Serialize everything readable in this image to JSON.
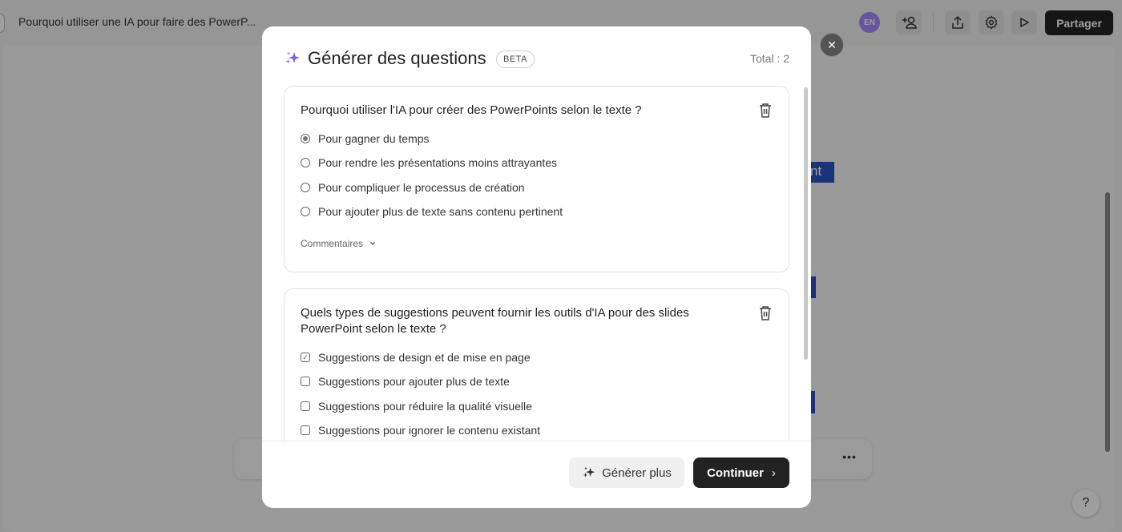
{
  "app": {
    "doc_title": "Pourquoi utiliser une IA pour faire des PowerP...",
    "avatar_initials": "EN",
    "add_user_icon": "+♀",
    "share_label": "Partager",
    "help_label": "?",
    "more_label": "•••",
    "behind_text": "nt"
  },
  "modal": {
    "title": "Générer des questions",
    "badge": "BETA",
    "total": "Total : 2",
    "close_label": "✕",
    "questions": [
      {
        "text": "Pourquoi utiliser l'IA pour créer des PowerPoints selon le texte ?",
        "type": "single",
        "options": [
          {
            "label": "Pour gagner du temps",
            "selected": true
          },
          {
            "label": "Pour rendre les présentations moins attrayantes",
            "selected": false
          },
          {
            "label": "Pour compliquer le processus de création",
            "selected": false
          },
          {
            "label": "Pour ajouter plus de texte sans contenu pertinent",
            "selected": false
          }
        ],
        "comments_label": "Commentaires"
      },
      {
        "text": "Quels types de suggestions peuvent fournir les outils d'IA pour des slides PowerPoint selon le texte ?",
        "type": "multiple",
        "options": [
          {
            "label": "Suggestions de design et de mise en page",
            "selected": true
          },
          {
            "label": "Suggestions pour ajouter plus de texte",
            "selected": false
          },
          {
            "label": "Suggestions pour réduire la qualité visuelle",
            "selected": false
          },
          {
            "label": "Suggestions pour ignorer le contenu existant",
            "selected": false
          }
        ]
      }
    ],
    "generate_more_label": "Générer plus",
    "continue_label": "Continuer",
    "continue_arrow": "›"
  },
  "colors": {
    "accent_purple": "#a78bfa",
    "primary_dark": "#222222",
    "slide_blue": "#2a55c4"
  }
}
